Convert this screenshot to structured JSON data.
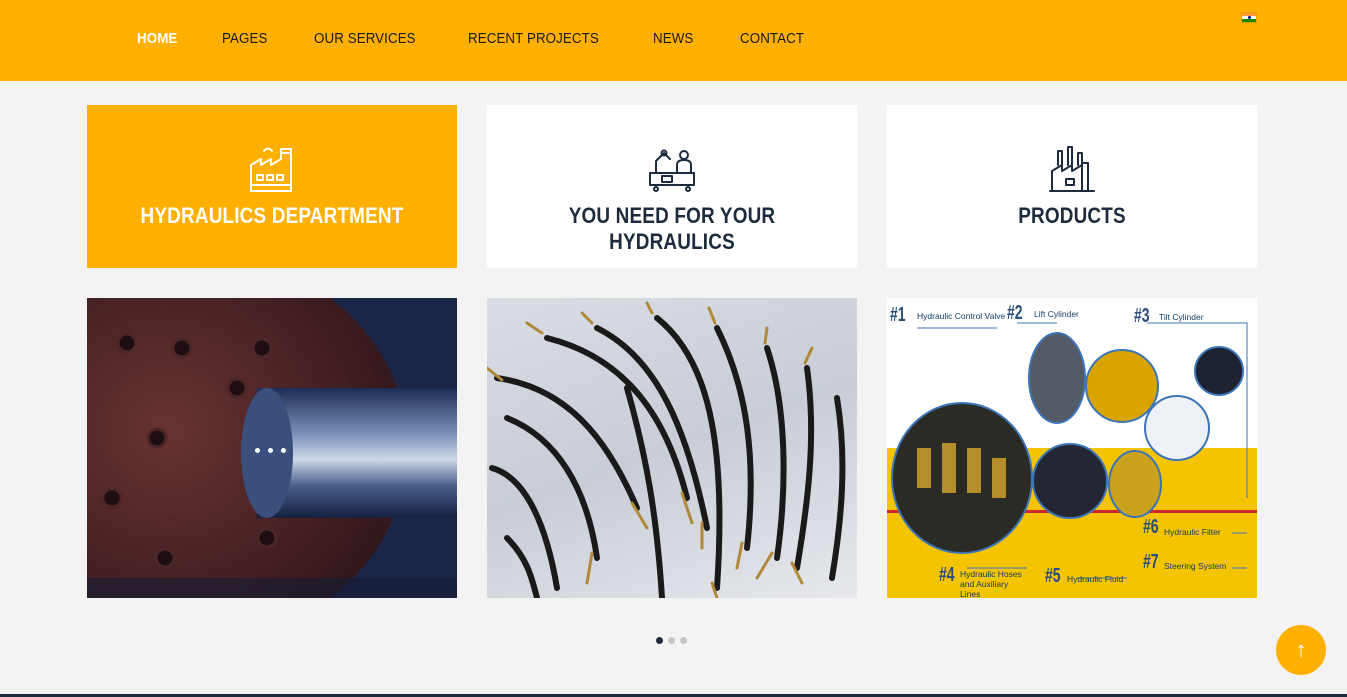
{
  "nav": {
    "items": [
      "HOME",
      "PAGES",
      "OUR SERVICES",
      "RECENT PROJECTS",
      "NEWS",
      "CONTACT"
    ],
    "active": "HOME",
    "language_icon": "india-flag-icon"
  },
  "cards": [
    {
      "title": "HYDRAULICS DEPARTMENT",
      "icon": "factory-icon",
      "highlighted": true
    },
    {
      "title": "YOU NEED FOR YOUR HYDRAULICS",
      "icon": "workers-machine-icon",
      "highlighted": false
    },
    {
      "title": "PRODUCTS",
      "icon": "industrial-plant-icon",
      "highlighted": false
    }
  ],
  "tiles": [
    {
      "image": "hydraulic-cylinder-photo",
      "loading": true
    },
    {
      "image": "hydraulic-hoses-photo"
    },
    {
      "image": "hydraulic-components-infographic",
      "labels": [
        {
          "num": "#1",
          "text": "Hydraulic Control Valve"
        },
        {
          "num": "#2",
          "text": "Lift Cylinder"
        },
        {
          "num": "#3",
          "text": "Tilt Cylinder"
        },
        {
          "num": "#4",
          "text": "Hydraulic Hoses and Auxiliary Lines"
        },
        {
          "num": "#5",
          "text": "Hydraulic Fluid"
        },
        {
          "num": "#6",
          "text": "Hydraulic Filter"
        },
        {
          "num": "#7",
          "text": "Steering System"
        }
      ]
    }
  ],
  "carousel": {
    "pages": 3,
    "current": 1
  },
  "back_to_top": {
    "icon": "arrow-up-icon",
    "glyph": "↑"
  },
  "colors": {
    "accent": "#ffb000",
    "dark": "#1c2b3d",
    "background": "#f3f3f3"
  }
}
